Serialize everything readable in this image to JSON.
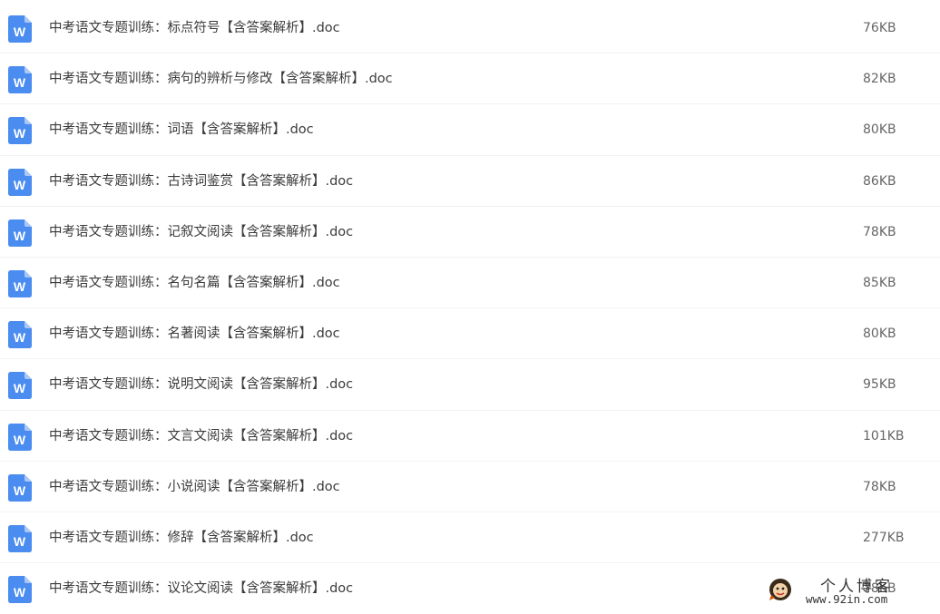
{
  "files": [
    {
      "name": "中考语文专题训练：标点符号【含答案解析】.doc",
      "size": "76KB",
      "icon": "word-doc-icon"
    },
    {
      "name": "中考语文专题训练：病句的辨析与修改【含答案解析】.doc",
      "size": "82KB",
      "icon": "word-doc-icon"
    },
    {
      "name": "中考语文专题训练：词语【含答案解析】.doc",
      "size": "80KB",
      "icon": "word-doc-icon"
    },
    {
      "name": "中考语文专题训练：古诗词鉴赏【含答案解析】.doc",
      "size": "86KB",
      "icon": "word-doc-icon"
    },
    {
      "name": "中考语文专题训练：记叙文阅读【含答案解析】.doc",
      "size": "78KB",
      "icon": "word-doc-icon"
    },
    {
      "name": "中考语文专题训练：名句名篇【含答案解析】.doc",
      "size": "85KB",
      "icon": "word-doc-icon"
    },
    {
      "name": "中考语文专题训练：名著阅读【含答案解析】.doc",
      "size": "80KB",
      "icon": "word-doc-icon"
    },
    {
      "name": "中考语文专题训练：说明文阅读【含答案解析】.doc",
      "size": "95KB",
      "icon": "word-doc-icon"
    },
    {
      "name": "中考语文专题训练：文言文阅读【含答案解析】.doc",
      "size": "101KB",
      "icon": "word-doc-icon"
    },
    {
      "name": "中考语文专题训练：小说阅读【含答案解析】.doc",
      "size": "78KB",
      "icon": "word-doc-icon"
    },
    {
      "name": "中考语文专题训练：修辞【含答案解析】.doc",
      "size": "277KB",
      "icon": "word-doc-icon"
    },
    {
      "name": "中考语文专题训练：议论文阅读【含答案解析】.doc",
      "size": "78KB",
      "icon": "word-doc-icon"
    }
  ],
  "watermark": {
    "title": "个人博客",
    "url": "www.92in.com"
  },
  "colors": {
    "doc_icon_blue": "#4a8cf0",
    "doc_icon_fold": "#a9c8f8",
    "row_divider": "#f0f2f5"
  }
}
